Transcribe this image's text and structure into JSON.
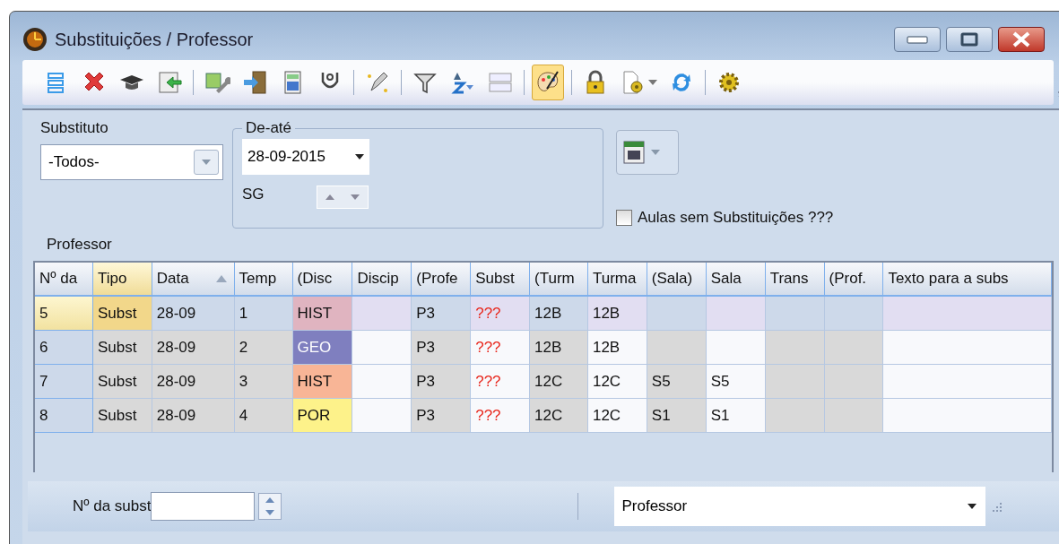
{
  "window": {
    "title": "Substituições / Professor"
  },
  "toolbar": {
    "groups": [
      [
        {
          "pressed": false
        },
        {
          "pressed": false
        },
        {
          "pressed": false
        },
        {
          "pressed": false
        }
      ],
      [
        {
          "pressed": false
        },
        {
          "pressed": false
        },
        {
          "pressed": false
        },
        {
          "pressed": false
        }
      ],
      [
        {
          "pressed": false
        }
      ],
      [
        {
          "pressed": false
        },
        {
          "pressed": false
        },
        {
          "pressed": false
        }
      ],
      [
        {
          "pressed": true
        }
      ],
      [
        {
          "pressed": false
        },
        {
          "pressed": false,
          "dropdown": true
        },
        {
          "pressed": false
        }
      ],
      [
        {
          "pressed": false
        }
      ]
    ]
  },
  "filters": {
    "substituto": {
      "label": "Substituto",
      "value": "-Todos-"
    },
    "range": {
      "legend": "De-até",
      "date": "28-09-2015",
      "day": "SG"
    },
    "empty_lessons": {
      "label": "Aulas sem Substituições ???",
      "checked": false
    },
    "section": "Professor"
  },
  "table": {
    "columns": [
      {
        "label": "Nº da",
        "kind": "index"
      },
      {
        "label": "Tipo",
        "kind": "plain",
        "editable": false,
        "focused": true
      },
      {
        "label": "Data",
        "kind": "plain",
        "editable": false,
        "sorted": true
      },
      {
        "label": "Temp",
        "kind": "plain",
        "editable": false
      },
      {
        "label": "(Disc",
        "kind": "subject"
      },
      {
        "label": "Discip",
        "kind": "plain",
        "editable": true
      },
      {
        "label": "(Profe",
        "kind": "plain",
        "editable": false
      },
      {
        "label": "Subst",
        "kind": "alert",
        "editable": true
      },
      {
        "label": "(Turm",
        "kind": "plain",
        "editable": false
      },
      {
        "label": "Turma",
        "kind": "plain",
        "editable": true
      },
      {
        "label": "(Sala)",
        "kind": "plain",
        "editable": false
      },
      {
        "label": "Sala",
        "kind": "plain",
        "editable": true
      },
      {
        "label": "Trans",
        "kind": "plain",
        "editable": false
      },
      {
        "label": "(Prof.",
        "kind": "plain",
        "editable": false
      },
      {
        "label": "Texto para a subs",
        "kind": "plain",
        "editable": true
      }
    ],
    "rows": [
      {
        "selected": true,
        "cells": [
          "5",
          "Subst",
          "28-09",
          "1",
          {
            "text": "HIST",
            "color": "#e0b4c0"
          },
          "",
          "P3",
          "???",
          "12B",
          "12B",
          "",
          "",
          "",
          "",
          ""
        ]
      },
      {
        "selected": false,
        "cells": [
          "6",
          "Subst",
          "28-09",
          "2",
          {
            "text": "GEO",
            "color": "#7f7fbf"
          },
          "",
          "P3",
          "???",
          "12B",
          "12B",
          "",
          "",
          "",
          "",
          ""
        ]
      },
      {
        "selected": false,
        "cells": [
          "7",
          "Subst",
          "28-09",
          "3",
          {
            "text": "HIST",
            "color": "#f8b596"
          },
          "",
          "P3",
          "???",
          "12C",
          "12C",
          "S5",
          "S5",
          "",
          "",
          ""
        ]
      },
      {
        "selected": false,
        "cells": [
          "8",
          "Subst",
          "28-09",
          "4",
          {
            "text": "POR",
            "color": "#fdf28a"
          },
          "",
          "P3",
          "???",
          "12C",
          "12C",
          "S1",
          "S1",
          "",
          "",
          ""
        ]
      }
    ]
  },
  "status_bar": {
    "number_label": "Nº da subst",
    "view": "Professor"
  }
}
